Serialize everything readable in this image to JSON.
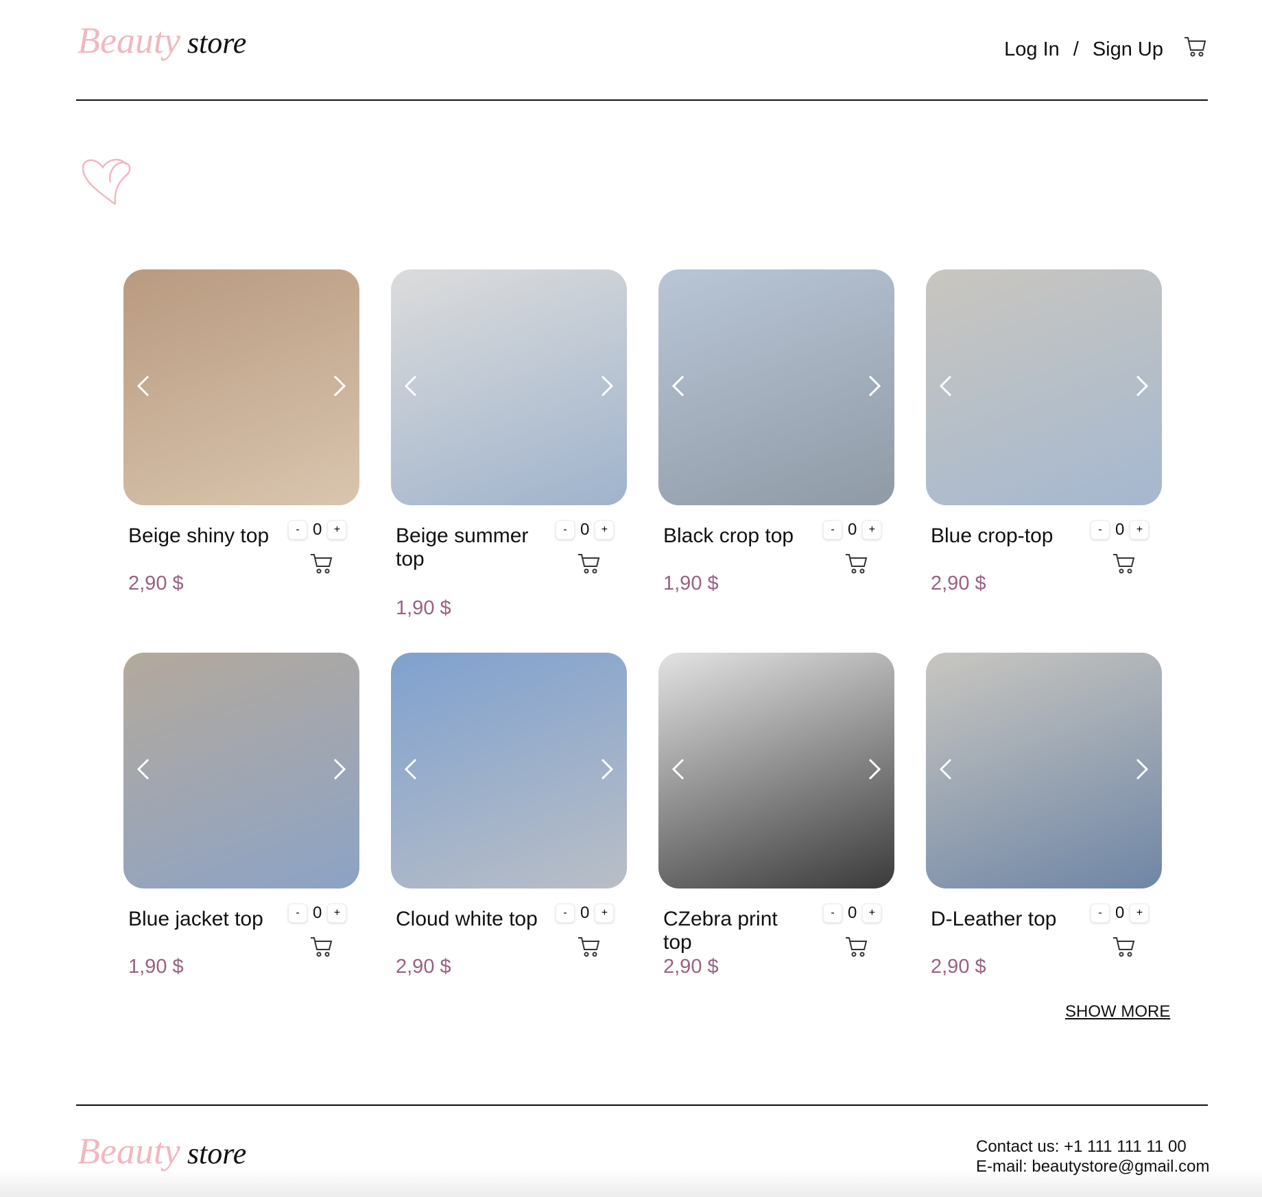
{
  "brand": {
    "part1": "Beauty",
    "part2": "store"
  },
  "nav": {
    "login": "Log In",
    "separator": "/",
    "signup": "Sign Up"
  },
  "products": [
    {
      "name": "Beige shiny top",
      "price": "2,90 $",
      "qty": "0",
      "colors": [
        "#b89a80",
        "#d9c5ae"
      ]
    },
    {
      "name": "Beige summer top",
      "price": "1,90 $",
      "qty": "0",
      "colors": [
        "#dcdcdc",
        "#9fb3cc"
      ]
    },
    {
      "name": "Black crop top",
      "price": "1,90 $",
      "qty": "0",
      "colors": [
        "#b9c6d6",
        "#8f9aa6"
      ]
    },
    {
      "name": "Blue crop-top",
      "price": "2,90 $",
      "qty": "0",
      "colors": [
        "#c9c6bf",
        "#a5b8d0"
      ]
    },
    {
      "name": "Blue jacket top",
      "price": "1,90 $",
      "qty": "0",
      "colors": [
        "#b4a99c",
        "#8ca3c6"
      ]
    },
    {
      "name": "Cloud white top",
      "price": "2,90 $",
      "qty": "0",
      "colors": [
        "#7fa1cf",
        "#b9bec6"
      ]
    },
    {
      "name": "CZebra print top",
      "price": "2,90 $",
      "qty": "0",
      "colors": [
        "#e3e3e3",
        "#3a3a3a"
      ]
    },
    {
      "name": "D-Leather top",
      "price": "2,90 $",
      "qty": "0",
      "colors": [
        "#c8c6c0",
        "#6f86a6"
      ]
    }
  ],
  "qty_minus": "-",
  "qty_plus": "+",
  "show_more": "SHOW MORE",
  "footer": {
    "contact": "Contact us: +1 111 111 11 00",
    "email": "E-mail: beautystore@gmail.com"
  }
}
